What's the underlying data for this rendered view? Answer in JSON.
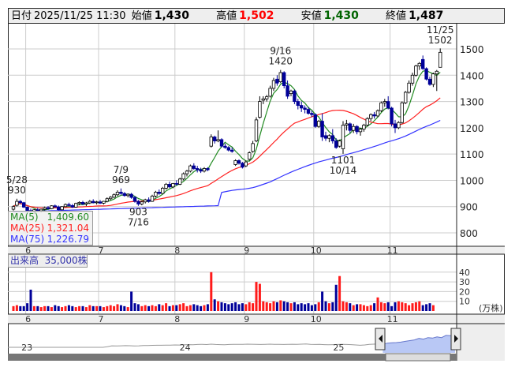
{
  "header": {
    "date_label": "日付",
    "datetime": "2025/11/25 11:30",
    "open_label": "始値",
    "open": "1,430",
    "high_label": "高値",
    "high": "1,502",
    "low_label": "安値",
    "low": "1,430",
    "close_label": "終値",
    "close": "1,487",
    "colors": {
      "high": "#ff0000",
      "low": "#006400",
      "default": "#222222"
    }
  },
  "legend": {
    "ma5": {
      "label": "MA(5)",
      "value": "1,409.60",
      "color": "#228b22"
    },
    "ma25": {
      "label": "MA(25)",
      "value": "1,321.04",
      "color": "#ff2020"
    },
    "ma75": {
      "label": "MA(75)",
      "value": "1,226.79",
      "color": "#3333ff"
    }
  },
  "volume_legend": {
    "label": "出来高",
    "value": "35,000株"
  },
  "annotations": [
    {
      "index": 1,
      "date": "5/28",
      "price": "930",
      "pos": "above"
    },
    {
      "index": 31,
      "date": "7/9",
      "price": "969",
      "pos": "above"
    },
    {
      "index": 36,
      "date": "7/16",
      "price": "903",
      "pos": "below"
    },
    {
      "index": 77,
      "date": "9/16",
      "price": "1420",
      "pos": "above"
    },
    {
      "index": 95,
      "date": "10/14",
      "price": "1101",
      "pos": "below"
    },
    {
      "index": 123,
      "date": "11/25",
      "price": "1502",
      "pos": "above"
    }
  ],
  "chart_data": {
    "type": "candlestick",
    "title": "",
    "price_axis": {
      "ticks": [
        800,
        900,
        1000,
        1100,
        1200,
        1300,
        1400,
        1500
      ],
      "range": [
        770,
        1590
      ]
    },
    "volume_axis": {
      "ticks": [
        10,
        20,
        30,
        40
      ],
      "unit": "(万株)"
    },
    "month_labels": [
      {
        "label": "6",
        "index": 4
      },
      {
        "label": "7",
        "index": 25
      },
      {
        "label": "8",
        "index": 47
      },
      {
        "label": "9",
        "index": 67
      },
      {
        "label": "10",
        "index": 87
      },
      {
        "label": "11",
        "index": 109
      }
    ],
    "ohlc": [
      [
        890,
        905,
        885,
        900
      ],
      [
        905,
        930,
        900,
        920
      ],
      [
        920,
        925,
        910,
        915
      ],
      [
        915,
        918,
        895,
        898
      ],
      [
        898,
        900,
        880,
        885
      ],
      [
        885,
        892,
        875,
        880
      ],
      [
        880,
        890,
        872,
        888
      ],
      [
        888,
        895,
        880,
        884
      ],
      [
        884,
        892,
        878,
        890
      ],
      [
        890,
        900,
        885,
        896
      ],
      [
        896,
        902,
        888,
        892
      ],
      [
        892,
        905,
        890,
        903
      ],
      [
        903,
        908,
        895,
        899
      ],
      [
        899,
        904,
        885,
        888
      ],
      [
        888,
        902,
        886,
        900
      ],
      [
        900,
        912,
        898,
        908
      ],
      [
        908,
        915,
        900,
        904
      ],
      [
        904,
        910,
        895,
        898
      ],
      [
        898,
        915,
        896,
        912
      ],
      [
        912,
        920,
        905,
        916
      ],
      [
        916,
        922,
        906,
        910
      ],
      [
        910,
        918,
        902,
        914
      ],
      [
        914,
        925,
        910,
        920
      ],
      [
        920,
        928,
        912,
        915
      ],
      [
        915,
        922,
        908,
        918
      ],
      [
        918,
        925,
        910,
        913
      ],
      [
        913,
        922,
        908,
        920
      ],
      [
        920,
        935,
        916,
        930
      ],
      [
        930,
        940,
        925,
        936
      ],
      [
        936,
        950,
        932,
        945
      ],
      [
        945,
        962,
        940,
        955
      ],
      [
        955,
        969,
        945,
        950
      ],
      [
        950,
        955,
        938,
        942
      ],
      [
        942,
        950,
        935,
        947
      ],
      [
        947,
        952,
        930,
        935
      ],
      [
        935,
        940,
        915,
        920
      ],
      [
        920,
        925,
        903,
        910
      ],
      [
        910,
        922,
        905,
        918
      ],
      [
        918,
        930,
        912,
        926
      ],
      [
        926,
        935,
        915,
        920
      ],
      [
        920,
        945,
        918,
        940
      ],
      [
        940,
        960,
        935,
        955
      ],
      [
        955,
        965,
        945,
        950
      ],
      [
        950,
        975,
        948,
        970
      ],
      [
        970,
        990,
        965,
        985
      ],
      [
        985,
        995,
        970,
        975
      ],
      [
        975,
        990,
        970,
        988
      ],
      [
        988,
        1000,
        980,
        985
      ],
      [
        985,
        1010,
        982,
        1005
      ],
      [
        1005,
        1030,
        1000,
        1025
      ],
      [
        1025,
        1040,
        1015,
        1035
      ],
      [
        1035,
        1060,
        1030,
        1055
      ],
      [
        1055,
        1065,
        1040,
        1045
      ],
      [
        1045,
        1055,
        1030,
        1040
      ],
      [
        1040,
        1048,
        1028,
        1035
      ],
      [
        1035,
        1050,
        1030,
        1045
      ],
      [
        1045,
        1050,
        1035,
        1040
      ],
      [
        1130,
        1175,
        1125,
        1165
      ],
      [
        1165,
        1170,
        1140,
        1150
      ],
      [
        1150,
        1190,
        1145,
        1155
      ],
      [
        1155,
        1160,
        1125,
        1130
      ],
      [
        1130,
        1140,
        1120,
        1125
      ],
      [
        1125,
        1130,
        1110,
        1115
      ],
      [
        1115,
        1125,
        1105,
        1110
      ],
      [
        1060,
        1080,
        1055,
        1075
      ],
      [
        1075,
        1080,
        1060,
        1065
      ],
      [
        1065,
        1070,
        1045,
        1050
      ],
      [
        1055,
        1075,
        1050,
        1070
      ],
      [
        1080,
        1110,
        1075,
        1105
      ],
      [
        1110,
        1150,
        1105,
        1140
      ],
      [
        1150,
        1240,
        1145,
        1230
      ],
      [
        1240,
        1320,
        1235,
        1300
      ],
      [
        1305,
        1320,
        1290,
        1310
      ],
      [
        1310,
        1325,
        1300,
        1318
      ],
      [
        1320,
        1360,
        1315,
        1350
      ],
      [
        1350,
        1390,
        1340,
        1380
      ],
      [
        1385,
        1400,
        1360,
        1370
      ],
      [
        1375,
        1420,
        1370,
        1410
      ],
      [
        1410,
        1415,
        1350,
        1360
      ],
      [
        1360,
        1380,
        1310,
        1320
      ],
      [
        1330,
        1345,
        1320,
        1340
      ],
      [
        1340,
        1345,
        1290,
        1300
      ],
      [
        1300,
        1310,
        1270,
        1285
      ],
      [
        1285,
        1300,
        1260,
        1275
      ],
      [
        1275,
        1285,
        1255,
        1270
      ],
      [
        1270,
        1280,
        1250,
        1255
      ],
      [
        1255,
        1265,
        1240,
        1250
      ],
      [
        1250,
        1255,
        1200,
        1205
      ],
      [
        1205,
        1230,
        1200,
        1225
      ],
      [
        1225,
        1255,
        1150,
        1165
      ],
      [
        1170,
        1185,
        1150,
        1160
      ],
      [
        1160,
        1175,
        1145,
        1170
      ],
      [
        1170,
        1195,
        1140,
        1150
      ],
      [
        1150,
        1160,
        1120,
        1125
      ],
      [
        1130,
        1155,
        1125,
        1150
      ],
      [
        1120,
        1225,
        1101,
        1210
      ],
      [
        1210,
        1230,
        1190,
        1215
      ],
      [
        1215,
        1220,
        1180,
        1190
      ],
      [
        1190,
        1215,
        1180,
        1205
      ],
      [
        1205,
        1210,
        1175,
        1185
      ],
      [
        1185,
        1200,
        1170,
        1195
      ],
      [
        1195,
        1215,
        1185,
        1210
      ],
      [
        1210,
        1240,
        1205,
        1235
      ],
      [
        1235,
        1255,
        1225,
        1250
      ],
      [
        1250,
        1260,
        1235,
        1245
      ],
      [
        1245,
        1270,
        1240,
        1265
      ],
      [
        1265,
        1300,
        1260,
        1295
      ],
      [
        1295,
        1310,
        1280,
        1300
      ],
      [
        1300,
        1320,
        1270,
        1275
      ],
      [
        1275,
        1280,
        1205,
        1215
      ],
      [
        1215,
        1230,
        1180,
        1200
      ],
      [
        1200,
        1225,
        1195,
        1220
      ],
      [
        1220,
        1300,
        1215,
        1295
      ],
      [
        1295,
        1340,
        1290,
        1335
      ],
      [
        1335,
        1380,
        1330,
        1370
      ],
      [
        1370,
        1410,
        1360,
        1400
      ],
      [
        1400,
        1440,
        1395,
        1435
      ],
      [
        1435,
        1450,
        1420,
        1445
      ],
      [
        1460,
        1475,
        1420,
        1425
      ],
      [
        1425,
        1430,
        1380,
        1385
      ],
      [
        1385,
        1395,
        1360,
        1365
      ],
      [
        1365,
        1410,
        1355,
        1405
      ],
      [
        1405,
        1420,
        1340,
        1415
      ],
      [
        1430,
        1502,
        1430,
        1487
      ]
    ],
    "volume": [
      5,
      6,
      5,
      5,
      8,
      22,
      5,
      5,
      4,
      5,
      5,
      4,
      6,
      5,
      4,
      5,
      6,
      5,
      4,
      5,
      5,
      4,
      6,
      5,
      5,
      5,
      4,
      5,
      6,
      5,
      7,
      6,
      5,
      4,
      20,
      8,
      7,
      5,
      6,
      5,
      6,
      5,
      7,
      6,
      8,
      5,
      6,
      6,
      7,
      8,
      5,
      6,
      7,
      6,
      5,
      6,
      7,
      40,
      12,
      10,
      9,
      8,
      7,
      8,
      9,
      7,
      8,
      7,
      9,
      8,
      30,
      28,
      10,
      9,
      8,
      10,
      9,
      11,
      10,
      9,
      8,
      9,
      7,
      8,
      7,
      8,
      6,
      7,
      9,
      20,
      10,
      8,
      9,
      27,
      36,
      10,
      9,
      8,
      6,
      7,
      7,
      6,
      5,
      6,
      8,
      14,
      9,
      8,
      9,
      5,
      9,
      10,
      9,
      8,
      6,
      8,
      9,
      10,
      6,
      7,
      8,
      6
    ],
    "series": [
      {
        "name": "MA(5)",
        "period": 5
      },
      {
        "name": "MA(25)",
        "period": 25
      },
      {
        "name": "MA(75)",
        "period": 75
      }
    ]
  },
  "navigator": {
    "year_labels": [
      {
        "label": "23",
        "index": 3
      },
      {
        "label": "24",
        "index": 38
      },
      {
        "label": "25",
        "index": 72
      }
    ],
    "selected_from_index": 83,
    "values": [
      600,
      600,
      600,
      600,
      600,
      600,
      600,
      600,
      600,
      600,
      600,
      600,
      600,
      600,
      600,
      600,
      600,
      600,
      600,
      600,
      600,
      600,
      640,
      700,
      690,
      700,
      710,
      705,
      690,
      700,
      720,
      715,
      730,
      740,
      735,
      745,
      750,
      760,
      755,
      770,
      780,
      770,
      790,
      800,
      785,
      810,
      790,
      780,
      775,
      790,
      800,
      795,
      800,
      810,
      805,
      800,
      790,
      800,
      810,
      800,
      795,
      790,
      800,
      805,
      800,
      810,
      820,
      800,
      790,
      795,
      780,
      770,
      780,
      790,
      800,
      790,
      780,
      760,
      740,
      760,
      800,
      810,
      820,
      800,
      880,
      900,
      920,
      950,
      1000,
      1050,
      1100,
      1200,
      1150,
      1250,
      1220,
      1300,
      1250,
      1400,
      1380,
      1487
    ]
  }
}
